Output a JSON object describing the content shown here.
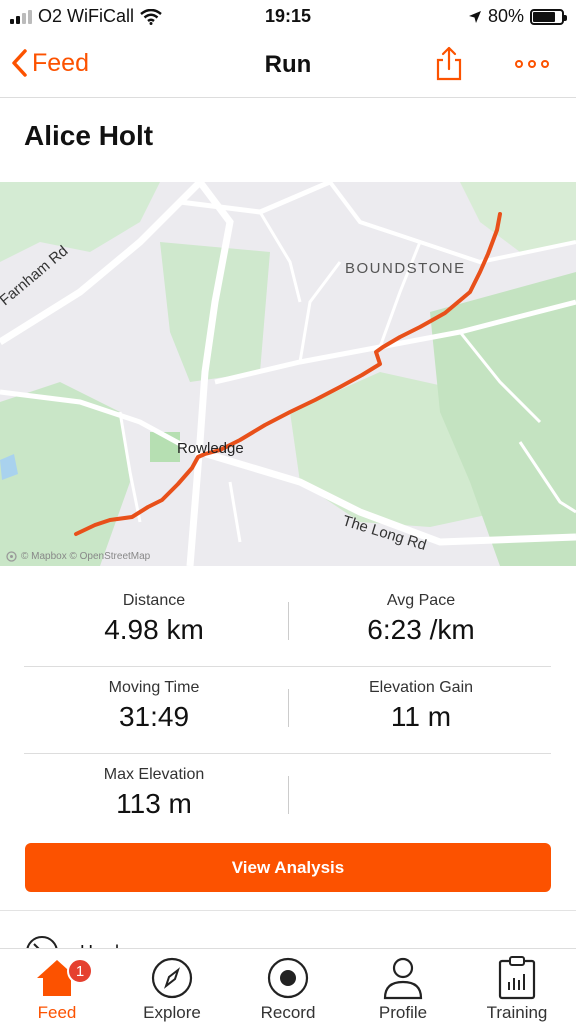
{
  "status_bar": {
    "carrier": "O2 WiFiCall",
    "time": "19:15",
    "battery": "80%",
    "battery_level": 0.8
  },
  "nav": {
    "back_label": "Feed",
    "title": "Run"
  },
  "activity": {
    "title": "Alice Holt"
  },
  "map": {
    "labels": {
      "road_farnham": "Farnham Rd",
      "place_boundstone": "BOUNDSTONE",
      "place_rowledge": "Rowledge",
      "road_long": "The Long Rd"
    },
    "attribution": "© Mapbox © OpenStreetMap",
    "route_color": "#e8501a"
  },
  "stats": [
    [
      {
        "label": "Distance",
        "value": "4.98 km"
      },
      {
        "label": "Avg Pace",
        "value": "6:23 /km"
      }
    ],
    [
      {
        "label": "Moving Time",
        "value": "31:49"
      },
      {
        "label": "Elevation Gain",
        "value": "11 m"
      }
    ],
    [
      {
        "label": "Max Elevation",
        "value": "113 m"
      }
    ]
  ],
  "actions": {
    "view_analysis": "View Analysis"
  },
  "effort": {
    "label": "Hard"
  },
  "tabs": [
    {
      "label": "Feed",
      "badge": "1"
    },
    {
      "label": "Explore"
    },
    {
      "label": "Record"
    },
    {
      "label": "Profile"
    },
    {
      "label": "Training"
    }
  ],
  "colors": {
    "accent": "#fc5200",
    "badge": "#e5402f"
  }
}
